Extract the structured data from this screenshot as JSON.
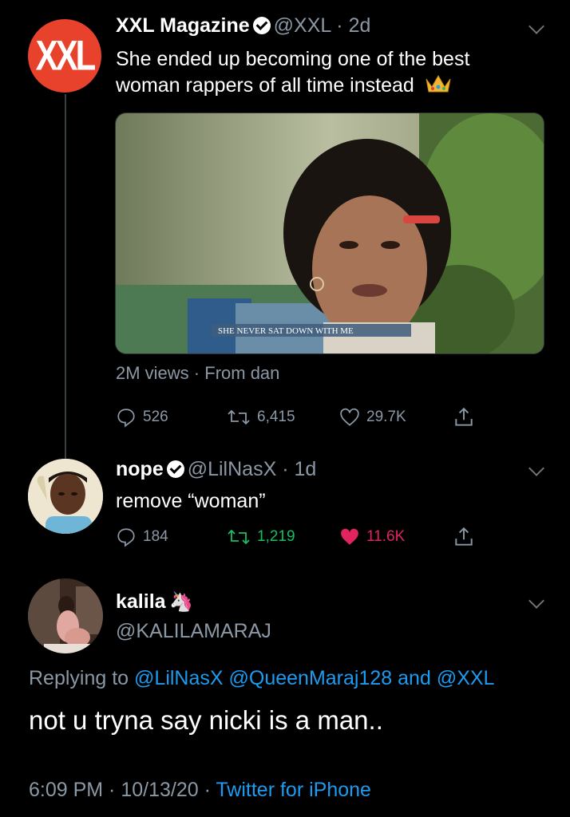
{
  "tweet1": {
    "avatar_text": "XXL",
    "name": "XXL Magazine",
    "handle": "@XXL",
    "time": "2d",
    "text_line1": "She ended up becoming one of the best",
    "text_line2": "woman rappers of all time instead",
    "video_caption": "SHE NEVER SAT DOWN WITH ME",
    "views": "2M views",
    "source": "From dan",
    "replies": "526",
    "retweets": "6,415",
    "likes": "29.7K"
  },
  "tweet2": {
    "name": "nope",
    "handle": "@LilNasX",
    "time": "1d",
    "text": "remove “woman”",
    "replies": "184",
    "retweets": "1,219",
    "likes": "11.6K",
    "retweet_color": "#17bf63",
    "like_color": "#e0245e"
  },
  "tweet3": {
    "name": "kalila",
    "name_emoji": "🦄",
    "handle": "@KALILAMARAJ",
    "replying_prefix": "Replying to",
    "reply_to_1": "@LilNasX",
    "reply_to_2": "@QueenMaraj128",
    "reply_and": "and",
    "reply_to_3": "@XXL",
    "text": "not u tryna say nicki is a man..",
    "timestamp": "6:09 PM · 10/13/20",
    "client": "Twitter for iPhone"
  },
  "colors": {
    "accent": "#1d9bf0",
    "muted": "#8b98a5",
    "xxl_red": "#e8412c"
  }
}
